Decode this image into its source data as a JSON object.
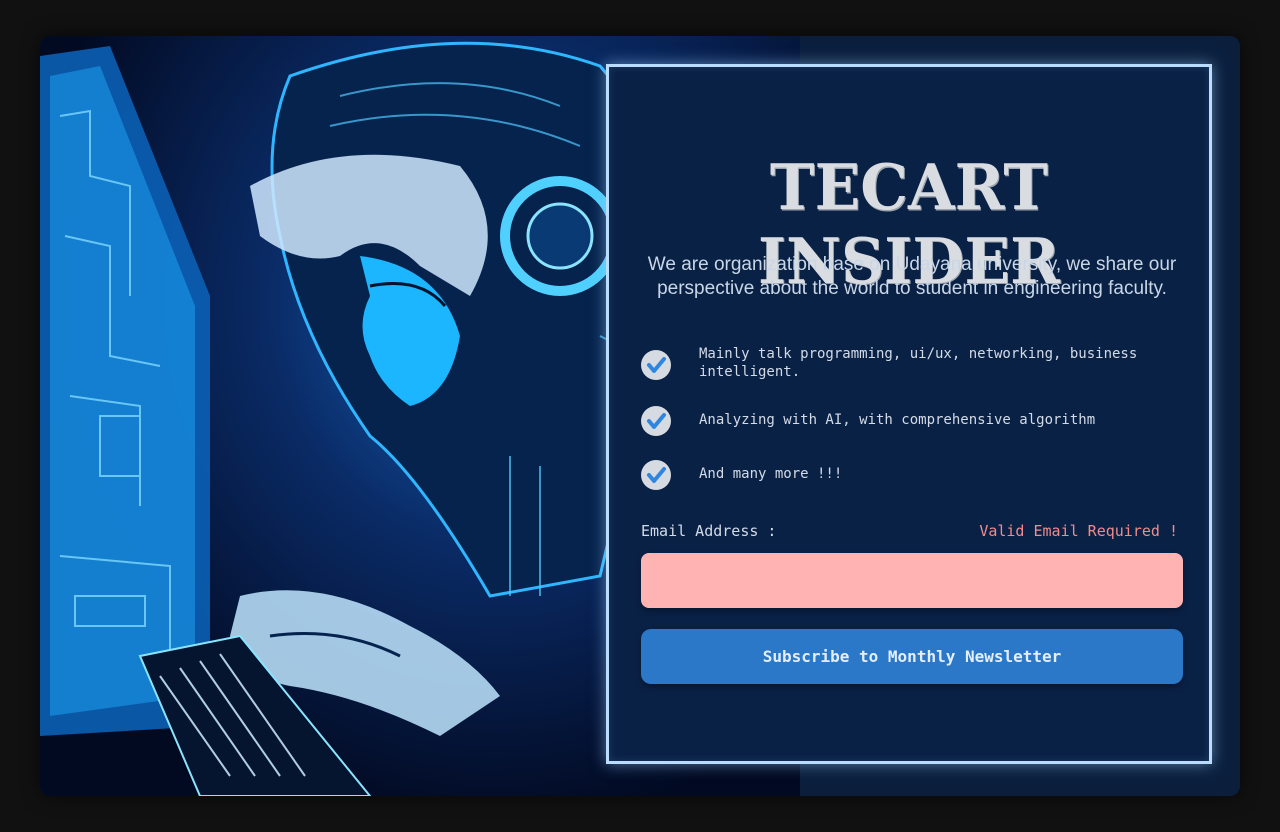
{
  "newsletter": {
    "title": "TECART INSIDER",
    "description": "We are organization base on Udayana university, we share our perspective about the world to student in engineering faculty.",
    "features": [
      "Mainly talk programming, ui/ux, networking, business intelligent.",
      "Analyzing with AI, with comprehensive algorithm",
      "And many more !!!"
    ],
    "email_label": "Email Address :",
    "email_error": "Valid Email Required !",
    "email_value": "",
    "subscribe_label": "Subscribe to Monthly Newsletter"
  },
  "icons": {
    "feature_check": "check-circle-icon"
  },
  "colors": {
    "page_bg": "#111111",
    "panel_bg": "#0a2146",
    "panel_border": "#b9dcff",
    "error_text": "#f08c8c",
    "input_error_bg": "#ffb4b3",
    "button_bg": "#2c78c8"
  }
}
